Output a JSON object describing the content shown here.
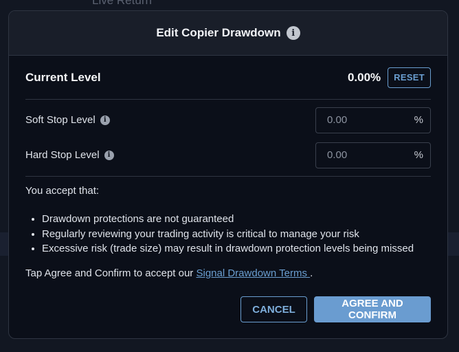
{
  "background": {
    "partial_text": "Live Return"
  },
  "modal": {
    "title": "Edit Copier Drawdown",
    "current_level": {
      "label": "Current Level",
      "value": "0.00%",
      "reset_label": "RESET"
    },
    "soft_stop": {
      "label": "Soft Stop Level",
      "placeholder": "0.00",
      "suffix": "%"
    },
    "hard_stop": {
      "label": "Hard Stop Level",
      "placeholder": "0.00",
      "suffix": "%"
    },
    "accept_intro": "You accept that:",
    "terms": [
      "Drawdown protections are not guaranteed",
      "Regularly reviewing your trading activity is critical to manage your risk",
      "Excessive risk (trade size) may result in drawdown protection levels being missed"
    ],
    "confirm_prefix": "Tap Agree and Confirm to accept our ",
    "confirm_link": "Signal Drawdown Terms ",
    "confirm_suffix": ".",
    "cancel_label": "CANCEL",
    "agree_label": "AGREE AND CONFIRM"
  },
  "colors": {
    "accent": "#6a9cd0",
    "modal_bg": "#0b0f19",
    "header_bg": "#191e29",
    "border": "#2f3542"
  },
  "icons": {
    "title_info": "info-icon",
    "field_info": "info-icon"
  }
}
